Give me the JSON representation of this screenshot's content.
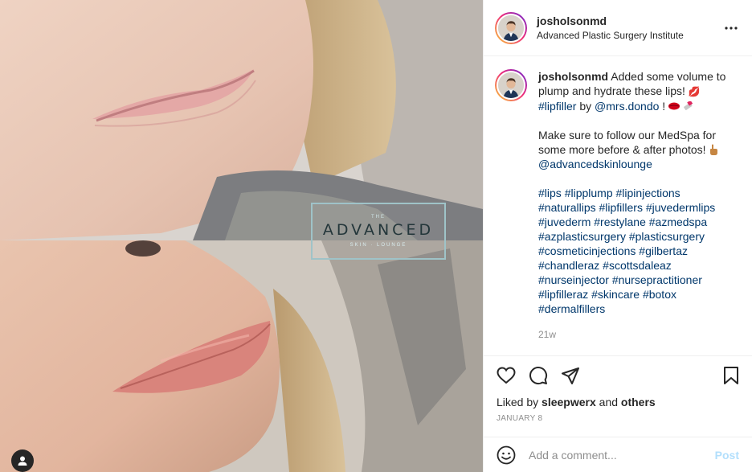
{
  "header": {
    "username": "josholsonmd",
    "location": "Advanced Plastic Surgery Institute",
    "more_icon": "more-options-icon"
  },
  "watermark": {
    "small_top": "THE",
    "main": "ADVANCED",
    "small_bottom": "SKIN · LOUNGE"
  },
  "caption": {
    "username": "josholsonmd",
    "line1": "Added some volume to plump and hydrate these lips!",
    "lips_emoji": "💋",
    "hashtag_lipfiller": "#lipfiller",
    "by": "by",
    "mention_dondo": "@mrs.dondo",
    "excl": "!",
    "paragraph2": "Make sure to follow our MedSpa for some more before & after photos!",
    "mention_lounge": "@advancedskinlounge",
    "hashtags": [
      "#lips",
      "#lipplump",
      "#lipinjections",
      "#naturallips",
      "#lipfillers",
      "#juvedermlips",
      "#juvederm",
      "#restylane",
      "#azmedspa",
      "#azplasticsurgery",
      "#plasticsurgery",
      "#cosmeticinjections",
      "#gilbertaz",
      "#chandleraz",
      "#scottsdaleaz",
      "#nurseinjector",
      "#nursepractitioner",
      "#lipfilleraz",
      "#skincare",
      "#botox",
      "#dermalfillers"
    ],
    "time": "21w"
  },
  "likes": {
    "prefix": "Liked by",
    "user": "sleepwerx",
    "and": "and",
    "others": "others"
  },
  "date": "JANUARY 8",
  "comment_box": {
    "placeholder": "Add a comment...",
    "post_label": "Post"
  },
  "colors": {
    "link": "#00376b",
    "muted": "#8e8e8e",
    "post_disabled": "#b2dffc",
    "border": "#efefef"
  }
}
